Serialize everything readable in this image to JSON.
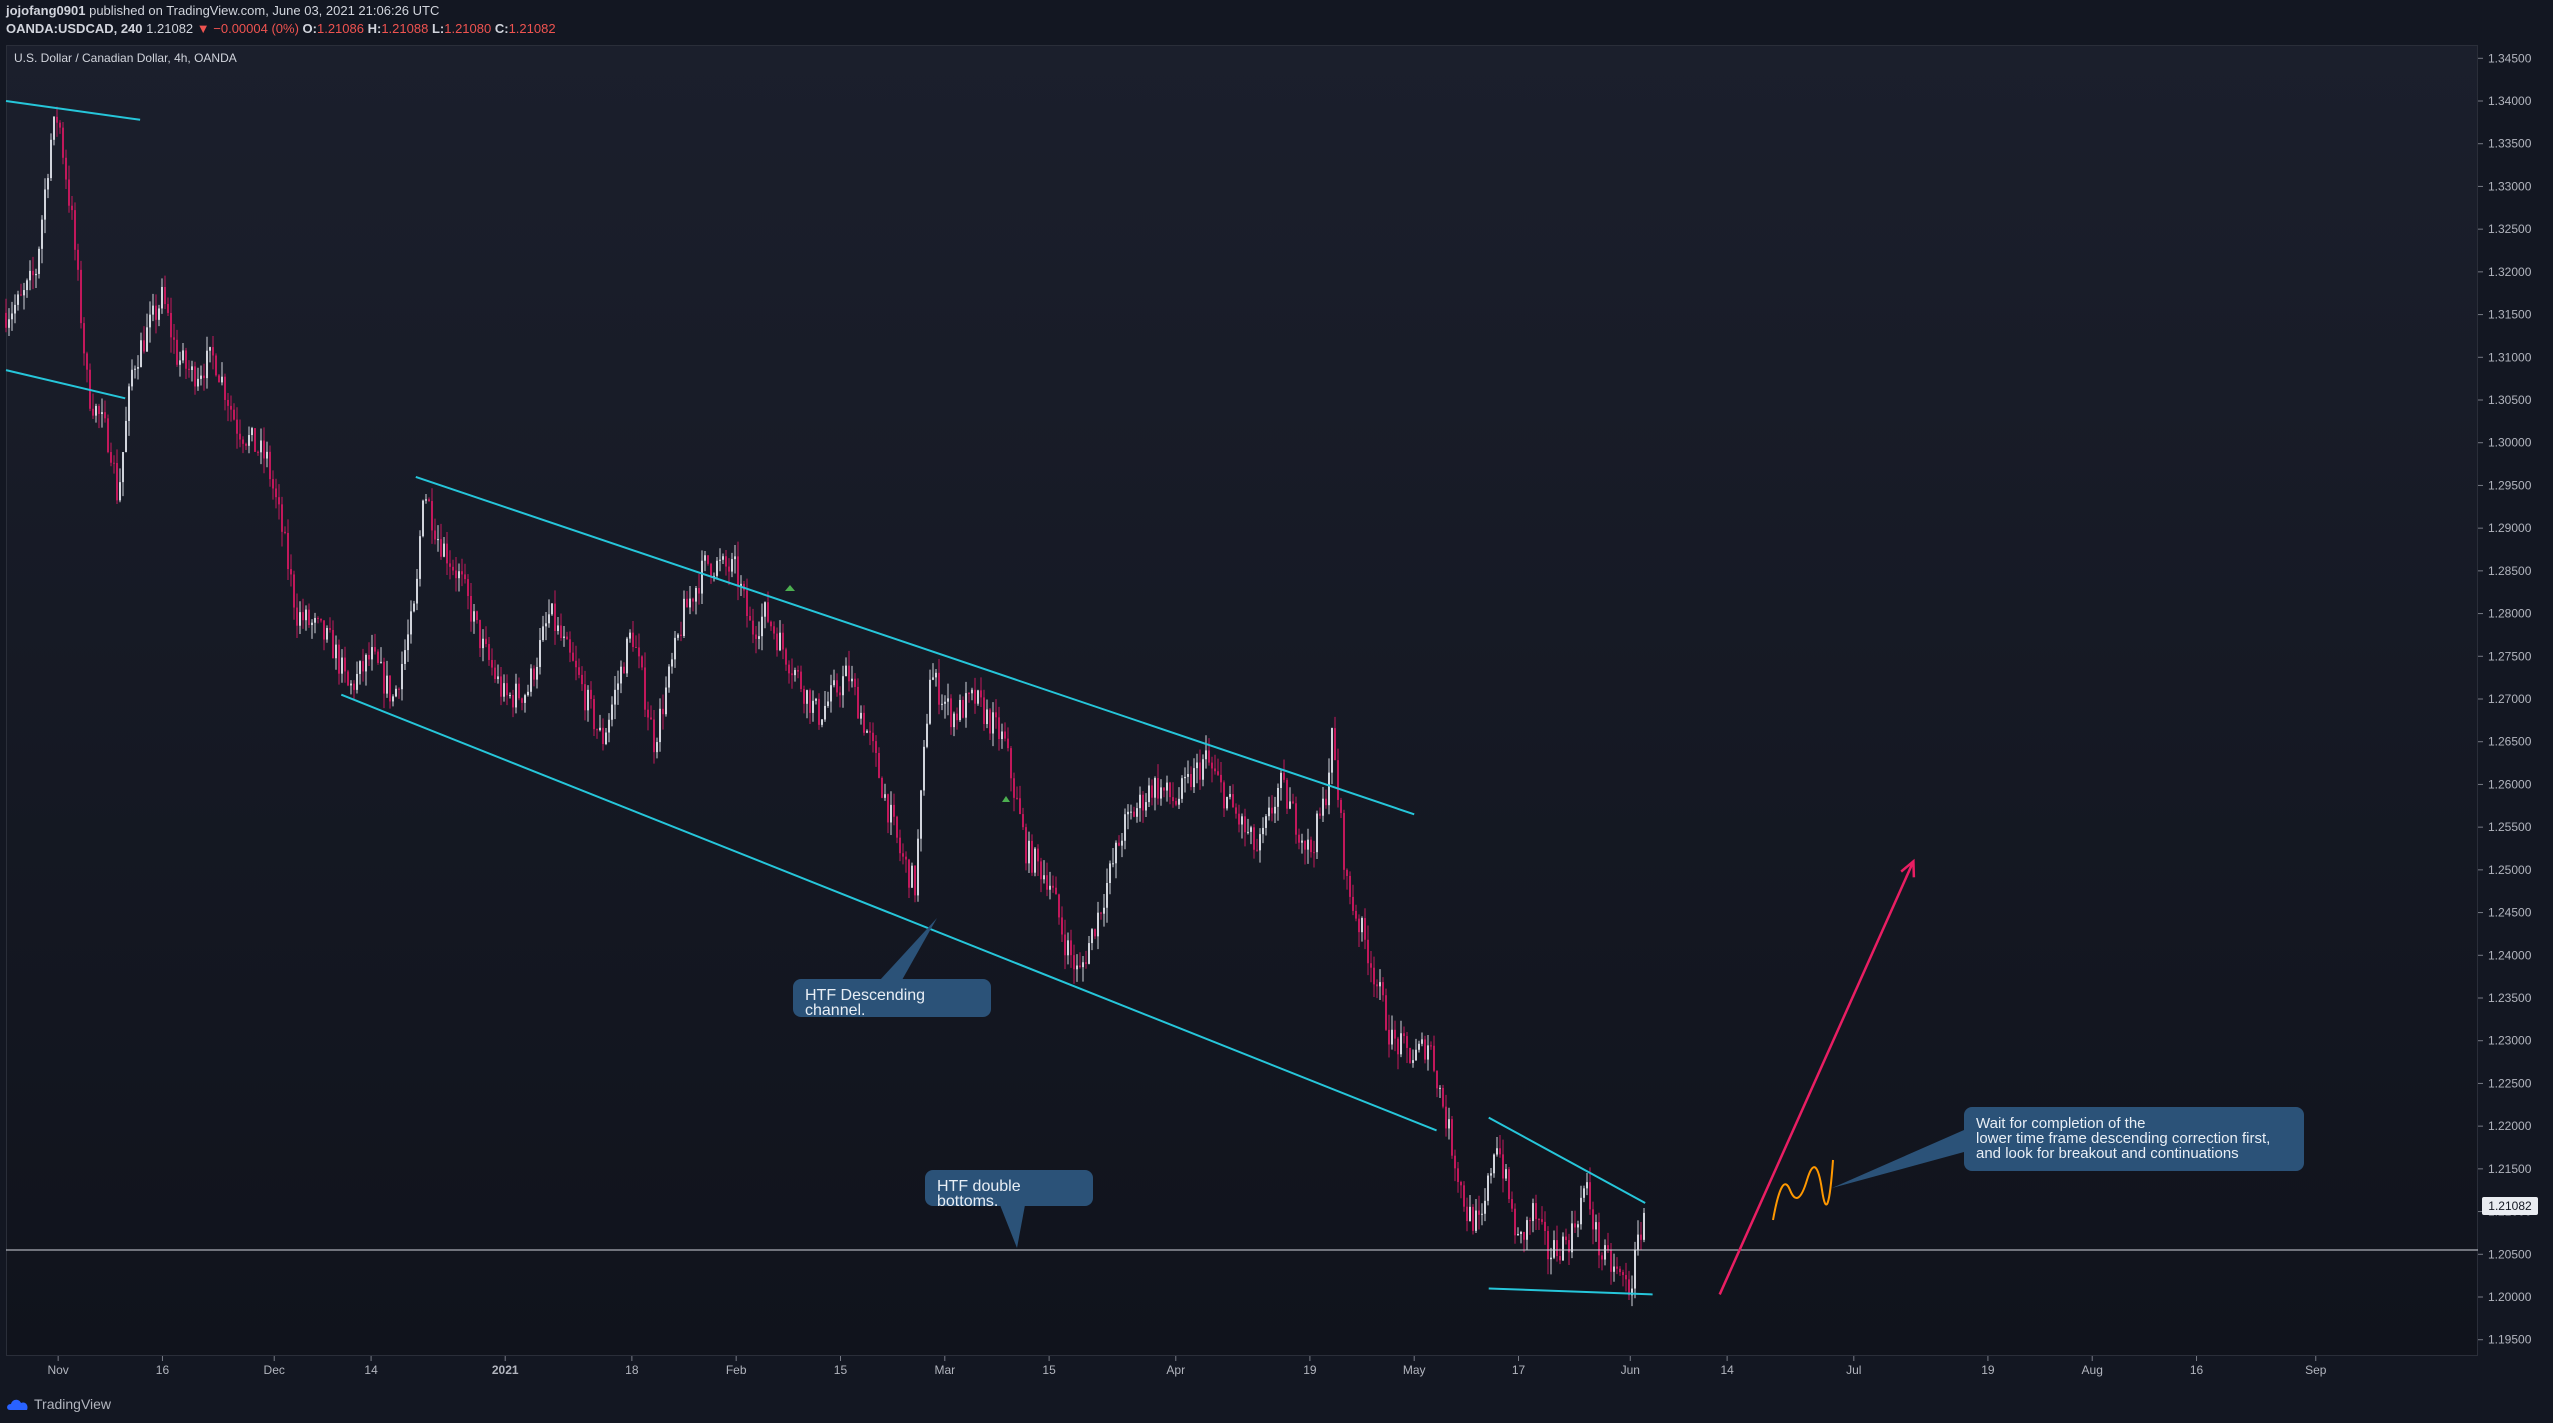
{
  "header": {
    "user": "jojofang0901",
    "published_text": "published on TradingView.com, June 03, 2021 21:06:26 UTC",
    "symbol": "OANDA:USDCAD, 240",
    "last": "1.21082",
    "change": "▼ −0.00004 (0%)",
    "o_label": "O:",
    "o_value": "1.21086",
    "h_label": "H:",
    "h_value": "1.21088",
    "l_label": "L:",
    "l_value": "1.21080",
    "c_label": "C:",
    "c_value": "1.21082"
  },
  "title": "U.S. Dollar / Canadian Dollar, 4h, OANDA",
  "annotations": {
    "channel": "HTF Descending channel.",
    "double_bottoms": "HTF double bottoms.",
    "wait_line1": "Wait for completion of the",
    "wait_line2": "lower time frame descending correction first,",
    "wait_line3": "and look for breakout and continuations"
  },
  "current_price_label": "1.21082",
  "footer": {
    "brand": "TradingView"
  },
  "colors": {
    "background": "#131722",
    "candle_up": "#d1d4dc",
    "candle_down": "#c2185b",
    "trendline": "#26c6da",
    "arrow": "#e91e63",
    "squiggle": "#ff9800",
    "callout": "#2b5278"
  },
  "chart_data": {
    "type": "candlestick",
    "ylim": [
      1.19,
      1.35
    ],
    "y_ticks": [
      "1.34500",
      "1.34000",
      "1.33500",
      "1.33000",
      "1.32500",
      "1.32000",
      "1.31500",
      "1.31000",
      "1.30500",
      "1.30000",
      "1.29500",
      "1.29000",
      "1.28500",
      "1.28000",
      "1.27500",
      "1.27000",
      "1.26500",
      "1.26000",
      "1.25500",
      "1.25000",
      "1.24500",
      "1.24000",
      "1.23500",
      "1.23000",
      "1.22500",
      "1.22000",
      "1.21500",
      "1.21000",
      "1.20500",
      "1.20000",
      "1.19500"
    ],
    "x_ticks": [
      "Nov",
      "16",
      "Dec",
      "14",
      "2021",
      "18",
      "Feb",
      "15",
      "Mar",
      "15",
      "Apr",
      "19",
      "May",
      "17",
      "Jun",
      "14",
      "Jul",
      "19",
      "Aug",
      "16",
      "Sep"
    ],
    "x_range": [
      "2020-10-26",
      "2021-09-06"
    ],
    "series": [
      {
        "values": [
          [
            "2020-10-26",
            1.3152
          ],
          [
            "2020-10-28",
            1.3165
          ],
          [
            "2020-10-30",
            1.32
          ],
          [
            "2020-11-01",
            1.3353
          ],
          [
            "2020-11-02",
            1.3385
          ],
          [
            "2020-11-04",
            1.325
          ],
          [
            "2020-11-06",
            1.306
          ],
          [
            "2020-11-09",
            1.3
          ],
          [
            "2020-11-10",
            1.2935
          ],
          [
            "2020-11-12",
            1.309
          ],
          [
            "2020-11-16",
            1.317
          ],
          [
            "2020-11-18",
            1.31
          ],
          [
            "2020-11-20",
            1.308
          ],
          [
            "2020-11-23",
            1.31
          ],
          [
            "2020-11-26",
            1.302
          ],
          [
            "2020-11-30",
            1.298
          ],
          [
            "2020-12-02",
            1.29
          ],
          [
            "2020-12-04",
            1.28
          ],
          [
            "2020-12-07",
            1.278
          ],
          [
            "2020-12-09",
            1.276
          ],
          [
            "2020-12-11",
            1.271
          ],
          [
            "2020-12-14",
            1.275
          ],
          [
            "2020-12-17",
            1.27
          ],
          [
            "2020-12-20",
            1.281
          ],
          [
            "2020-12-21",
            1.295
          ],
          [
            "2020-12-23",
            1.289
          ],
          [
            "2020-12-26",
            1.284
          ],
          [
            "2020-12-29",
            1.276
          ],
          [
            "2021-01-01",
            1.27
          ],
          [
            "2021-01-04",
            1.271
          ],
          [
            "2021-01-07",
            1.28
          ],
          [
            "2021-01-11",
            1.272
          ],
          [
            "2021-01-14",
            1.265
          ],
          [
            "2021-01-18",
            1.278
          ],
          [
            "2021-01-21",
            1.265
          ],
          [
            "2021-01-25",
            1.28
          ],
          [
            "2021-01-28",
            1.286
          ],
          [
            "2021-02-01",
            1.285
          ],
          [
            "2021-02-03",
            1.278
          ],
          [
            "2021-02-05",
            1.28
          ],
          [
            "2021-02-09",
            1.273
          ],
          [
            "2021-02-12",
            1.268
          ],
          [
            "2021-02-16",
            1.273
          ],
          [
            "2021-02-19",
            1.265
          ],
          [
            "2021-02-23",
            1.252
          ],
          [
            "2021-02-25",
            1.248
          ],
          [
            "2021-02-27",
            1.273
          ],
          [
            "2021-03-02",
            1.268
          ],
          [
            "2021-03-05",
            1.27
          ],
          [
            "2021-03-09",
            1.265
          ],
          [
            "2021-03-12",
            1.252
          ],
          [
            "2021-03-15",
            1.249
          ],
          [
            "2021-03-17",
            1.242
          ],
          [
            "2021-03-19",
            1.2375
          ],
          [
            "2021-03-22",
            1.246
          ],
          [
            "2021-03-25",
            1.255
          ],
          [
            "2021-03-29",
            1.26
          ],
          [
            "2021-04-01",
            1.258
          ],
          [
            "2021-04-05",
            1.263
          ],
          [
            "2021-04-08",
            1.258
          ],
          [
            "2021-04-12",
            1.252
          ],
          [
            "2021-04-15",
            1.26
          ],
          [
            "2021-04-19",
            1.252
          ],
          [
            "2021-04-21",
            1.258
          ],
          [
            "2021-04-22",
            1.2655
          ],
          [
            "2021-04-24",
            1.248
          ],
          [
            "2021-04-27",
            1.24
          ],
          [
            "2021-04-30",
            1.23
          ],
          [
            "2021-05-03",
            1.228
          ],
          [
            "2021-05-05",
            1.23
          ],
          [
            "2021-05-07",
            1.222
          ],
          [
            "2021-05-10",
            1.21
          ],
          [
            "2021-05-12",
            1.208
          ],
          [
            "2021-05-14",
            1.219
          ],
          [
            "2021-05-17",
            1.206
          ],
          [
            "2021-05-19",
            1.21
          ],
          [
            "2021-05-21",
            1.205
          ],
          [
            "2021-05-24",
            1.207
          ],
          [
            "2021-05-26",
            1.213
          ],
          [
            "2021-05-28",
            1.205
          ],
          [
            "2021-06-01",
            1.201
          ],
          [
            "2021-06-03",
            1.2108
          ]
        ]
      }
    ],
    "drawings": {
      "channel_upper_top": [
        [
          "2020-12-20",
          1.296
        ],
        [
          "2021-05-03",
          1.2565
        ]
      ],
      "channel_lower_bottom": [
        [
          "2020-12-10",
          1.2705
        ],
        [
          "2021-05-06",
          1.2195
        ]
      ],
      "early_upper": [
        [
          "2020-10-26",
          1.34
        ],
        [
          "2020-11-13",
          1.3378
        ]
      ],
      "early_lower": [
        [
          "2020-10-26",
          1.3085
        ],
        [
          "2020-11-11",
          1.3052
        ]
      ],
      "ltf_upper": [
        [
          "2021-05-13",
          1.221
        ],
        [
          "2021-06-03",
          1.211
        ]
      ],
      "ltf_lower": [
        [
          "2021-05-13",
          1.201
        ],
        [
          "2021-06-04",
          1.2003
        ]
      ],
      "support_horizontal": 1.2055,
      "projection_arrow": [
        [
          "2021-06-13",
          1.2003
        ],
        [
          "2021-07-09",
          1.251
        ]
      ]
    }
  }
}
